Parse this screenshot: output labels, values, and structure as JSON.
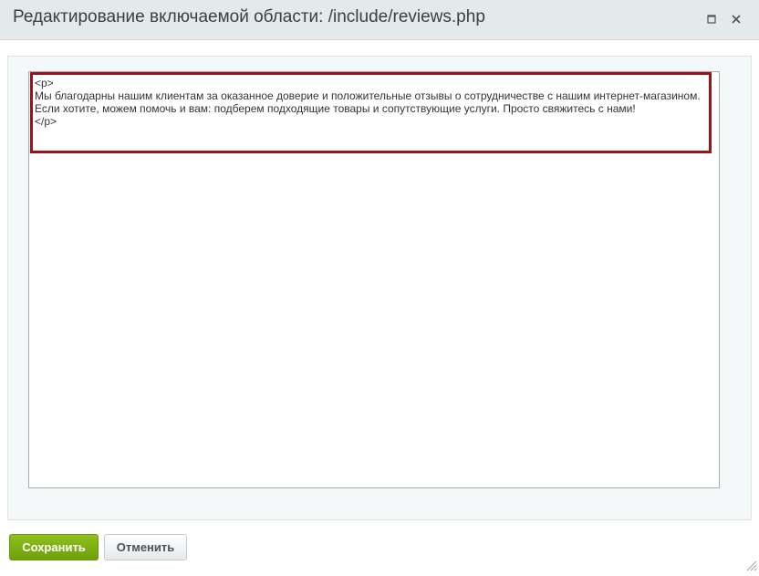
{
  "dialog": {
    "title": "Редактирование включаемой области: /include/reviews.php"
  },
  "editor": {
    "content": "<p>\nМы благодарны нашим клиентам за оказанное доверие и положительные отзывы о сотрудничестве с нашим интернет-магазином. Если хотите, можем помочь и вам: подберем подходящие товары и сопутствующие услуги. Просто свяжитесь с нами!\n</p>"
  },
  "buttons": {
    "save_label": "Сохранить",
    "cancel_label": "Отменить"
  },
  "icons": {
    "maximize": "maximize-icon",
    "close": "close-icon",
    "resize": "resize-grip-icon"
  },
  "colors": {
    "highlight": "#a01018",
    "save_button": "#7cae12"
  }
}
